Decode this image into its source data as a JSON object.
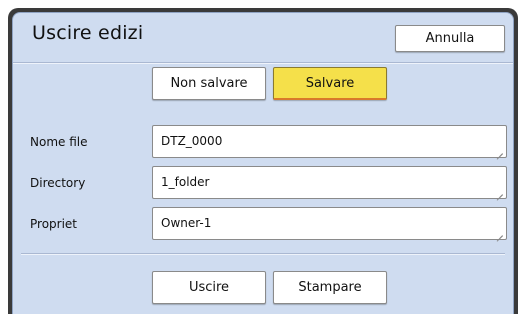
{
  "dialog": {
    "title": "Uscire edizi",
    "cancel_label": "Annulla"
  },
  "save_choice": {
    "no_save_label": "Non salvare",
    "save_label": "Salvare",
    "selected": "Salvare"
  },
  "fields": [
    {
      "label": "Nome file",
      "value": "DTZ_0000"
    },
    {
      "label": "Directory",
      "value": "1_folder"
    },
    {
      "label": "Propriet",
      "value": "Owner-1"
    }
  ],
  "actions": {
    "exit_label": "Uscire",
    "print_label": "Stampare"
  },
  "colors": {
    "dialog_bg": "#cfdcf0",
    "frame": "#3a3a3a",
    "selected_button": "#f5e04a",
    "selected_underline": "#d97a2a"
  }
}
